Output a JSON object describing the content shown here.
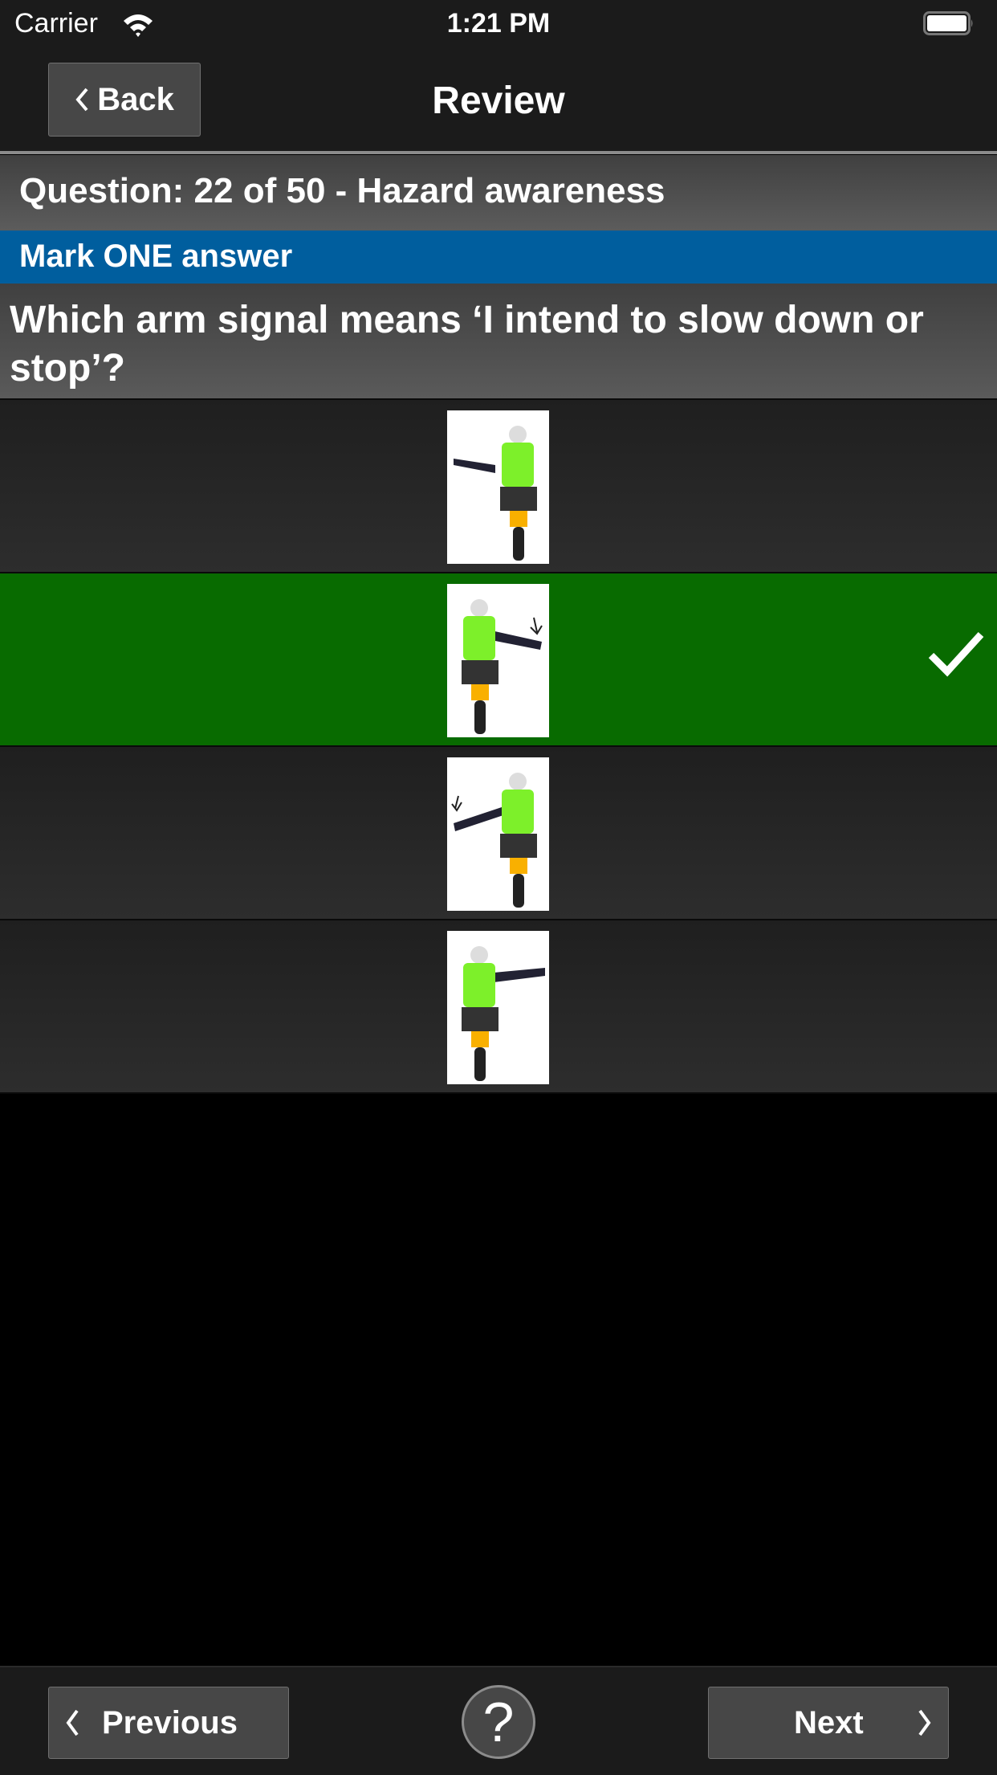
{
  "status_bar": {
    "carrier": "Carrier",
    "time": "1:21 PM",
    "battery_level": 1.0
  },
  "nav": {
    "back_label": "Back",
    "title": "Review"
  },
  "question": {
    "header": "Question: 22 of 50 - Hazard awareness",
    "instruction": "Mark ONE answer",
    "text": "Which arm signal means ‘I intend to slow down or stop’?"
  },
  "answers": [
    {
      "image": "rider-right-arm-straight-out",
      "correct": false
    },
    {
      "image": "rider-right-arm-waving-up-down",
      "correct": true
    },
    {
      "image": "rider-left-arm-waving-up-down",
      "correct": false
    },
    {
      "image": "rider-arm-straight-out-right",
      "correct": false
    }
  ],
  "toolbar": {
    "previous_label": "Previous",
    "help_label": "?",
    "next_label": "Next"
  },
  "colors": {
    "correct": "#086b00",
    "instruction_band": "#005e9e",
    "bar": "#1b1b1b"
  }
}
